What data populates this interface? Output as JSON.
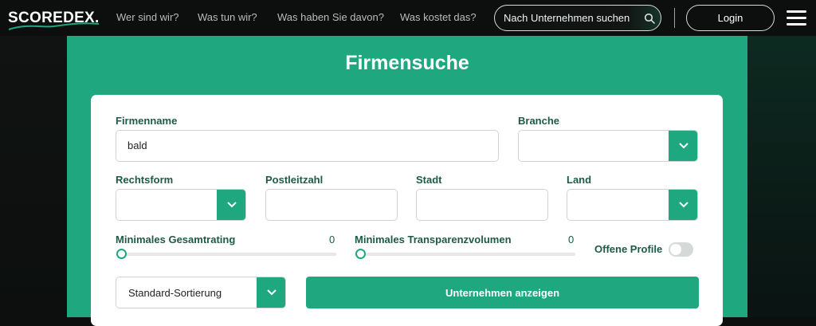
{
  "header": {
    "logo_text": "SCOREDEX.",
    "nav": [
      "Wer sind wir?",
      "Was tun wir?",
      "Was haben Sie davon?",
      "Was kostet das?"
    ],
    "search_placeholder": "Nach Unternehmen suchen",
    "login_label": "Login"
  },
  "search_form": {
    "title": "Firmensuche",
    "firmenname": {
      "label": "Firmenname",
      "value": "bald"
    },
    "branche": {
      "label": "Branche",
      "value": ""
    },
    "rechtsform": {
      "label": "Rechtsform",
      "value": ""
    },
    "postleitzahl": {
      "label": "Postleitzahl",
      "value": ""
    },
    "stadt": {
      "label": "Stadt",
      "value": ""
    },
    "land": {
      "label": "Land",
      "value": ""
    },
    "min_gesamtrating": {
      "label": "Minimales Gesamtrating",
      "value": "0"
    },
    "min_transparenzvolumen": {
      "label": "Minimales Transparenzvolumen",
      "value": "0"
    },
    "offene_profile": {
      "label": "Offene Profile",
      "enabled": false
    },
    "sortierung": "Standard-Sortierung",
    "submit_label": "Unternehmen anzeigen"
  },
  "colors": {
    "accent": "#1fa77f",
    "label_text": "#1e5a45",
    "page_bg": "#0c0f0e"
  },
  "icons": [
    "search-icon",
    "chevron-down-icon",
    "menu-icon",
    "logo-swoosh-icon"
  ]
}
